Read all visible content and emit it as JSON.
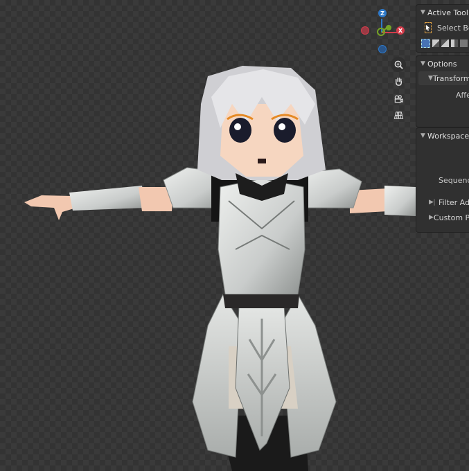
{
  "gizmo": {
    "z_label": "Z",
    "x_label": "X",
    "colors": {
      "x": "#d33c4b",
      "y": "#75a426",
      "z": "#2e79c9",
      "x_neg": "#9a3a44",
      "z_neg": "#2a5589"
    },
    "buttons": [
      "zoom-icon",
      "hand-pan-icon",
      "camera-icon",
      "grid-perspective-icon"
    ]
  },
  "sidebar": {
    "active_tool": {
      "header": "Active Tool",
      "tool_label": "Select Bo"
    },
    "options": {
      "header": "Options",
      "transform_label": "Transform",
      "affect_label": "Affe"
    },
    "workspace": {
      "header": "Workspace",
      "sequencer_label": "Sequencer",
      "filter_label": "Filter Ad",
      "custom_label": "Custom Pro"
    }
  },
  "colors": {
    "viewport_bg": "#3a3a3a",
    "panel_bg": "#303030",
    "accent_orange": "#e0a243",
    "accent_blue": "#4772b3"
  }
}
